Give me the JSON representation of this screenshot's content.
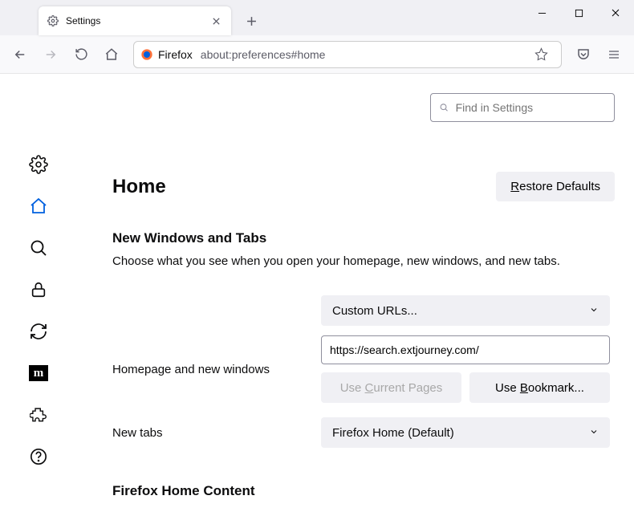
{
  "titlebar": {
    "tab_label": "Settings"
  },
  "navbar": {
    "url_prefix": "Firefox",
    "url": "about:preferences#home"
  },
  "search": {
    "placeholder": "Find in Settings"
  },
  "page": {
    "title": "Home",
    "restore_label": "Restore Defaults"
  },
  "section_windows_tabs": {
    "title": "New Windows and Tabs",
    "desc": "Choose what you see when you open your homepage, new windows, and new tabs.",
    "homepage_label": "Homepage and new windows",
    "homepage_select": "Custom URLs...",
    "homepage_value": "https://search.extjourney.com/",
    "use_current": "Use Current Pages",
    "use_bookmark": "Use Bookmark...",
    "newtabs_label": "New tabs",
    "newtabs_select": "Firefox Home (Default)"
  },
  "section_home_content": {
    "title": "Firefox Home Content"
  }
}
